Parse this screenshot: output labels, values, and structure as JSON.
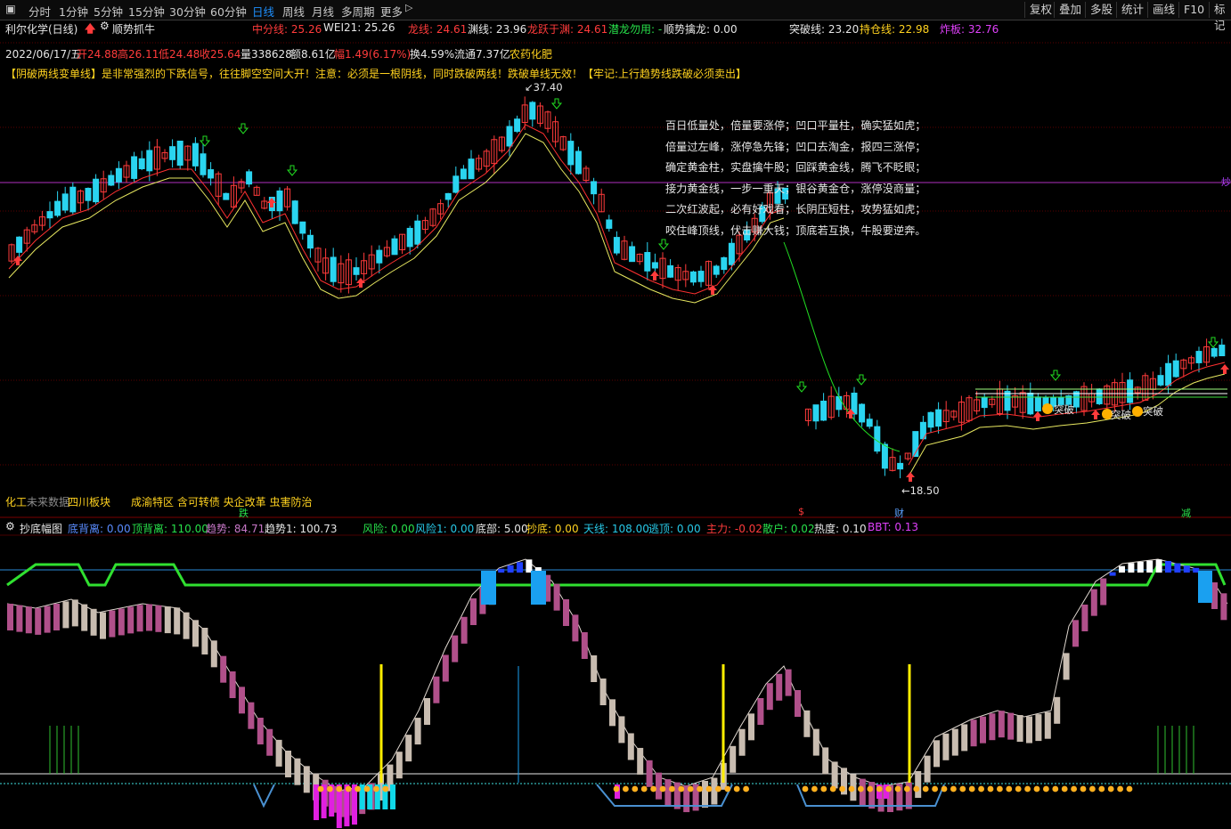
{
  "toolbar": {
    "periods": [
      "分时",
      "1分钟",
      "5分钟",
      "15分钟",
      "30分钟",
      "60分钟",
      "日线",
      "周线",
      "月线",
      "多周期",
      "更多"
    ],
    "active": "日线",
    "right_buttons": [
      "复权",
      "叠加",
      "多股",
      "统计",
      "画线",
      "F10",
      "标记"
    ]
  },
  "header": {
    "stock": "利尔化学(日线)",
    "indicator": "顺势抓牛",
    "zhongfen": "中分线: 25.26",
    "wei21": "WEI21: 25.26",
    "longxian": "龙线: 24.61",
    "yuanxian": "渊线: 23.96",
    "longyue": "龙跃于渊: 24.61",
    "qianlong": "潜龙勿用: -",
    "shunshi": "顺势擒龙: 0.00",
    "tupo": "突破线: 23.20",
    "chicang": "持仓线: 22.98",
    "zhaban": "炸板: 32.76"
  },
  "quote": {
    "date": "2022/06/17/五",
    "open": "开24.88",
    "high": "高26.11",
    "low": "低24.48",
    "close": "收25.64",
    "vol": "量338628",
    "amt": "额8.61亿",
    "chg": "幅1.49(6.17%)",
    "turn": "换4.59%",
    "float": "流通7.37亿",
    "sector": "农药化肥"
  },
  "notice": "【阴破两线变单线】是非常强烈的下跌信号，往往脚空空间大开！注意：必须是一根阴线，同时跌破两线！跌破单线无效！【牢记:上行趋势线跌破必须卖出】",
  "poem": [
    "百日低量处，倍量要涨停；凹口平量柱，确实猛如虎；",
    "倍量过左峰，涨停急先锋；凹口去淘金，报四三涨停；",
    "确定黄金柱，实盘擒牛股；回踩黄金线，腾飞不眨眼；",
    "接力黄金线，一步一重天；银谷黄金仓，涨停没商量；",
    "二次红波起，必有好戏看；长阴压短柱，攻势猛如虎；",
    "咬住峰顶线，伏击赚大钱；顶底若互换，牛股要逆奔。"
  ],
  "price_labels": {
    "high": "37.40",
    "low": "18.50"
  },
  "signals": {
    "tupo1": "突破",
    "tupo2": "突破",
    "tupo3": "突破",
    "die": "跌",
    "jian": "减",
    "cai": "财",
    "dollar": "$"
  },
  "info_bar": {
    "left": "化工",
    "nodata": "未来数据",
    "board": "四川板块",
    "concepts": "成渝特区 含可转债 央企改革 虫害防治"
  },
  "sub_header": {
    "name": "抄底幅图",
    "dibeili": "底背离: 0.00",
    "dingbeili": "顶背离: 110.00",
    "qushi": "趋势: 84.71",
    "qushi1": "趋势1: 100.73",
    "fengxian": "风险: 0.00",
    "fengxian1": "风险1: 0.00",
    "dibu": "底部: 5.00",
    "chaodi": "抄底: 0.00",
    "tianxian": "天线: 108.00",
    "taoding": "逃顶: 0.00",
    "zhuli": "主力: -0.02",
    "sanhu": "散户: 0.02",
    "redu": "热度: 0.10",
    "bbt": "BBT: 0.13"
  },
  "colors": {
    "up": "#ff3b3b",
    "down": "#2ad4f0",
    "ma_yellow": "#e8e860",
    "ma_red": "#ff3030",
    "ma_green": "#22dd22"
  }
}
